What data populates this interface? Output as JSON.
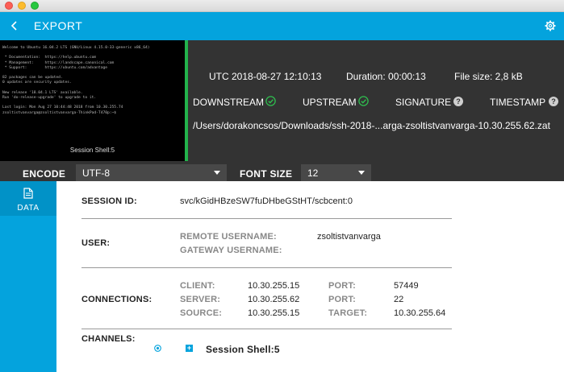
{
  "header": {
    "title": "EXPORT",
    "back_icon": "chevron-left-icon",
    "settings_icon": "gear-icon"
  },
  "terminal": {
    "lines": [
      "Welcome to Ubuntu 16.04.2 LTS (GNU/Linux 4.15.0-33-generic x86_64)",
      "",
      " * Documentation:  https://help.ubuntu.com",
      " * Management:     https://landscape.canonical.com",
      " * Support:        https://ubuntu.com/advantage",
      "",
      "82 packages can be updated.",
      "0 updates are security updates.",
      "",
      "New release '18.04.1 LTS' available.",
      "Run 'do-release-upgrade' to upgrade to it.",
      "",
      "Last login: Mon Aug 27 10:44:48 2018 from 10.30.255.74",
      "zsoltistvanvarga@zsoltistvanvarga-ThinkPad-T470p:~$ "
    ],
    "caption": "Session Shell:5"
  },
  "info": {
    "timestamp": "UTC 2018-08-27 12:10:13",
    "duration": "Duration: 00:00:13",
    "filesize": "File size: 2,8 kB",
    "downstream": "DOWNSTREAM",
    "upstream": "UPSTREAM",
    "signature": "SIGNATURE",
    "timestamp_label": "TIMESTAMP",
    "path": "/Users/dorakoncsos/Downloads/ssh-2018-...arga-zsoltistvanvarga-10.30.255.62.zat"
  },
  "controls": {
    "encode_label": "ENCODE",
    "encode_value": "UTF-8",
    "font_size_label": "FONT SIZE",
    "font_size_value": "12"
  },
  "nav": {
    "data_label": "DATA",
    "data_icon": "document-icon"
  },
  "details": {
    "session_id_label": "SESSION ID:",
    "session_id_value": "svc/kGidHBzeSW7fuDHbeGStHT/scbcent:0",
    "user_label": "USER:",
    "remote_username_label": "REMOTE USERNAME:",
    "remote_username_value": "zsoltistvanvarga",
    "gateway_username_label": "GATEWAY USERNAME:",
    "connections_label": "CONNECTIONS:",
    "client_label": "CLIENT:",
    "client_value": "10.30.255.15",
    "server_label": "SERVER:",
    "server_value": "10.30.255.62",
    "source_label": "SOURCE:",
    "source_value": "10.30.255.15",
    "port1_label": "PORT:",
    "port1_value": "57449",
    "port2_label": "PORT:",
    "port2_value": "22",
    "target_label": "TARGET:",
    "target_value": "10.30.255.64",
    "channels_label": "CHANNELS:",
    "channel_name": "Session Shell:5"
  },
  "colors": {
    "accent": "#04a3dd",
    "ok": "#2fbf4f",
    "panel": "#333333"
  }
}
